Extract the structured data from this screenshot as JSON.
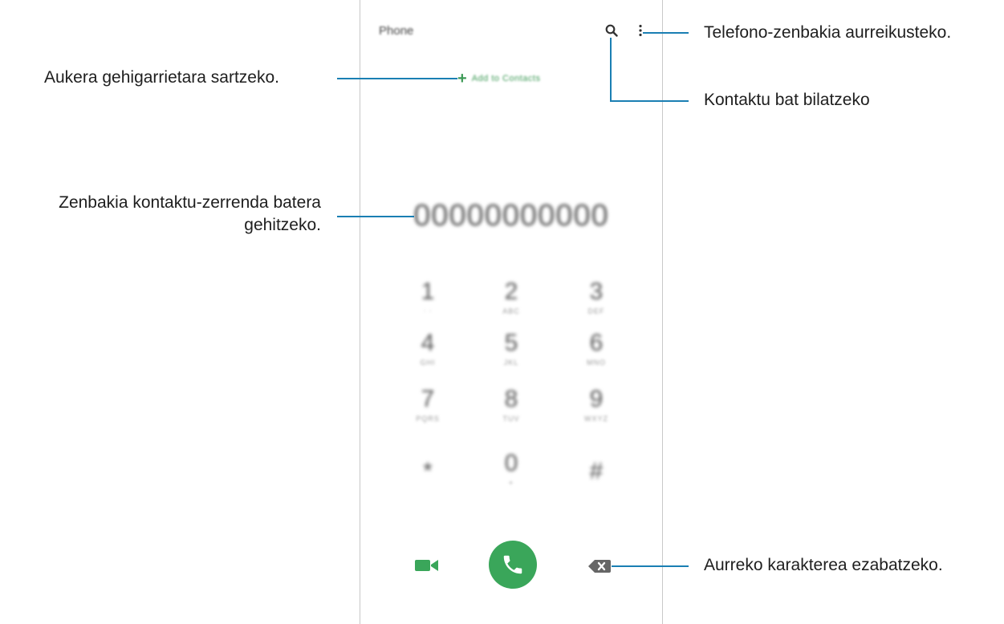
{
  "phone": {
    "app_title": "Phone",
    "add_number_label": "Add to Contacts",
    "number_display": "00000000000",
    "keypad": [
      {
        "digit": "1",
        "letters": "ᐧ ᐧ"
      },
      {
        "digit": "2",
        "letters": "ABC"
      },
      {
        "digit": "3",
        "letters": "DEF"
      },
      {
        "digit": "4",
        "letters": "GHI"
      },
      {
        "digit": "5",
        "letters": "JKL"
      },
      {
        "digit": "6",
        "letters": "MNO"
      },
      {
        "digit": "7",
        "letters": "PQRS"
      },
      {
        "digit": "8",
        "letters": "TUV"
      },
      {
        "digit": "9",
        "letters": "WXYZ"
      },
      {
        "digit": "*",
        "letters": ""
      },
      {
        "digit": "0",
        "letters": "+"
      },
      {
        "digit": "#",
        "letters": ""
      }
    ],
    "icons": {
      "search": "search-icon",
      "more": "more-options-icon",
      "video": "video-call-icon",
      "call": "phone-call-icon",
      "backspace": "backspace-icon"
    },
    "accent_color": "#3aa65a"
  },
  "callouts": {
    "more_options": "Telefono-zenbakia aurreikusteko.",
    "add_number": "Aukera gehigarrietara sartzeko.",
    "search": "Kontaktu bat bilatzeko",
    "number_display_line1": "Zenbakia kontaktu-zerrenda batera",
    "number_display_line2": "gehitzeko.",
    "backspace": "Aurreko karakterea ezabatzeko."
  },
  "callout_color": "#1a7fb3"
}
